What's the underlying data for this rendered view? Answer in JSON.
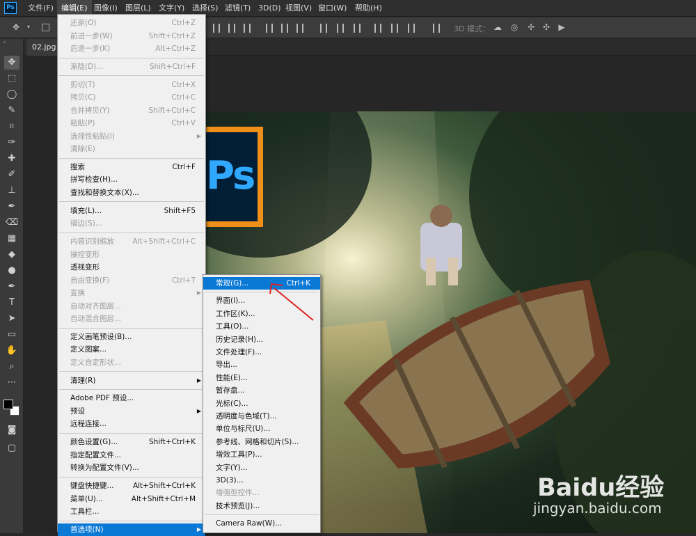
{
  "app": {
    "logo": "Ps"
  },
  "menubar": [
    {
      "label": "文件(F)",
      "active": false
    },
    {
      "label": "编辑(E)",
      "active": true
    },
    {
      "label": "图像(I)",
      "active": false
    },
    {
      "label": "图层(L)",
      "active": false
    },
    {
      "label": "文字(Y)",
      "active": false
    },
    {
      "label": "选择(S)",
      "active": false
    },
    {
      "label": "滤镜(T)",
      "active": false
    },
    {
      "label": "3D(D)",
      "active": false
    },
    {
      "label": "视图(V)",
      "active": false
    },
    {
      "label": "窗口(W)",
      "active": false
    },
    {
      "label": "帮助(H)",
      "active": false
    }
  ],
  "options_bar": {
    "mode_3d_label": "3D 模式："
  },
  "document_tab": {
    "label": "02.jpg @"
  },
  "toolbar": {
    "tools": [
      "move-tool-icon",
      "marquee-tool-icon",
      "lasso-tool-icon",
      "quick-select-icon",
      "crop-tool-icon",
      "eyedropper-icon",
      "healing-brush-icon",
      "brush-tool-icon",
      "clone-stamp-icon",
      "history-brush-icon",
      "eraser-icon",
      "gradient-icon",
      "blur-icon",
      "dodge-icon",
      "pen-tool-icon",
      "type-tool-icon",
      "path-select-icon",
      "rectangle-tool-icon",
      "hand-tool-icon",
      "zoom-tool-icon",
      "more-tools-icon"
    ],
    "colors": {
      "foreground": "#000000",
      "background": "#ffffff"
    }
  },
  "edit_menu": {
    "items": [
      {
        "label": "还原(O)",
        "shortcut": "Ctrl+Z",
        "disabled": true
      },
      {
        "label": "前进一步(W)",
        "shortcut": "Shift+Ctrl+Z",
        "disabled": true
      },
      {
        "label": "后退一步(K)",
        "shortcut": "Alt+Ctrl+Z",
        "disabled": true
      },
      {
        "sep": true
      },
      {
        "label": "渐隐(D)...",
        "shortcut": "Shift+Ctrl+F",
        "disabled": true
      },
      {
        "sep": true
      },
      {
        "label": "剪切(T)",
        "shortcut": "Ctrl+X",
        "disabled": true
      },
      {
        "label": "拷贝(C)",
        "shortcut": "Ctrl+C",
        "disabled": true
      },
      {
        "label": "合并拷贝(Y)",
        "shortcut": "Shift+Ctrl+C",
        "disabled": true
      },
      {
        "label": "粘贴(P)",
        "shortcut": "Ctrl+V",
        "disabled": true
      },
      {
        "label": "选择性粘贴(I)",
        "arrow": true,
        "disabled": true
      },
      {
        "label": "清除(E)",
        "disabled": true
      },
      {
        "sep": true
      },
      {
        "label": "搜索",
        "shortcut": "Ctrl+F"
      },
      {
        "label": "拼写检查(H)..."
      },
      {
        "label": "查找和替换文本(X)..."
      },
      {
        "sep": true
      },
      {
        "label": "填充(L)...",
        "shortcut": "Shift+F5"
      },
      {
        "label": "描边(S)...",
        "disabled": true
      },
      {
        "sep": true
      },
      {
        "label": "内容识别缩放",
        "shortcut": "Alt+Shift+Ctrl+C",
        "disabled": true
      },
      {
        "label": "操控变形",
        "disabled": true
      },
      {
        "label": "透视变形"
      },
      {
        "label": "自由变换(F)",
        "shortcut": "Ctrl+T",
        "disabled": true
      },
      {
        "label": "变换",
        "arrow": true,
        "disabled": true
      },
      {
        "label": "自动对齐图层...",
        "disabled": true
      },
      {
        "label": "自动混合图层...",
        "disabled": true
      },
      {
        "sep": true
      },
      {
        "label": "定义画笔预设(B)..."
      },
      {
        "label": "定义图案..."
      },
      {
        "label": "定义自定形状...",
        "disabled": true
      },
      {
        "sep": true
      },
      {
        "label": "清理(R)",
        "arrow": true
      },
      {
        "sep": true
      },
      {
        "label": "Adobe PDF 预设..."
      },
      {
        "label": "预设",
        "arrow": true
      },
      {
        "label": "远程连接..."
      },
      {
        "sep": true
      },
      {
        "label": "颜色设置(G)...",
        "shortcut": "Shift+Ctrl+K"
      },
      {
        "label": "指定配置文件..."
      },
      {
        "label": "转换为配置文件(V)..."
      },
      {
        "sep": true
      },
      {
        "label": "键盘快捷键...",
        "shortcut": "Alt+Shift+Ctrl+K"
      },
      {
        "label": "菜单(U)...",
        "shortcut": "Alt+Shift+Ctrl+M"
      },
      {
        "label": "工具栏..."
      },
      {
        "sep": true
      },
      {
        "label": "首选项(N)",
        "arrow": true,
        "highlight": true
      }
    ]
  },
  "preferences_menu": {
    "items": [
      {
        "label": "常规(G)...",
        "shortcut": "Ctrl+K",
        "highlight": true
      },
      {
        "sep": true
      },
      {
        "label": "界面(I)..."
      },
      {
        "label": "工作区(K)..."
      },
      {
        "label": "工具(O)..."
      },
      {
        "label": "历史记录(H)..."
      },
      {
        "label": "文件处理(F)..."
      },
      {
        "label": "导出..."
      },
      {
        "label": "性能(E)..."
      },
      {
        "label": "暂存盘..."
      },
      {
        "label": "光标(C)..."
      },
      {
        "label": "透明度与色域(T)..."
      },
      {
        "label": "单位与标尺(U)..."
      },
      {
        "label": "参考线、网格和切片(S)..."
      },
      {
        "label": "增效工具(P)..."
      },
      {
        "label": "文字(Y)..."
      },
      {
        "label": "3D(3)..."
      },
      {
        "label": "增强型控件...",
        "disabled": true
      },
      {
        "label": "技术预览(J)..."
      },
      {
        "sep": true
      },
      {
        "label": "Camera Raw(W)..."
      }
    ]
  },
  "canvas": {
    "logo_text": "Ps"
  },
  "watermark": {
    "brand": "Baidu经验",
    "url": "jingyan.baidu.com"
  },
  "accent_colors": {
    "menu_highlight": "#0a79d6",
    "annotation_arrow": "#e02020",
    "ps_blue": "#31a8ff"
  }
}
